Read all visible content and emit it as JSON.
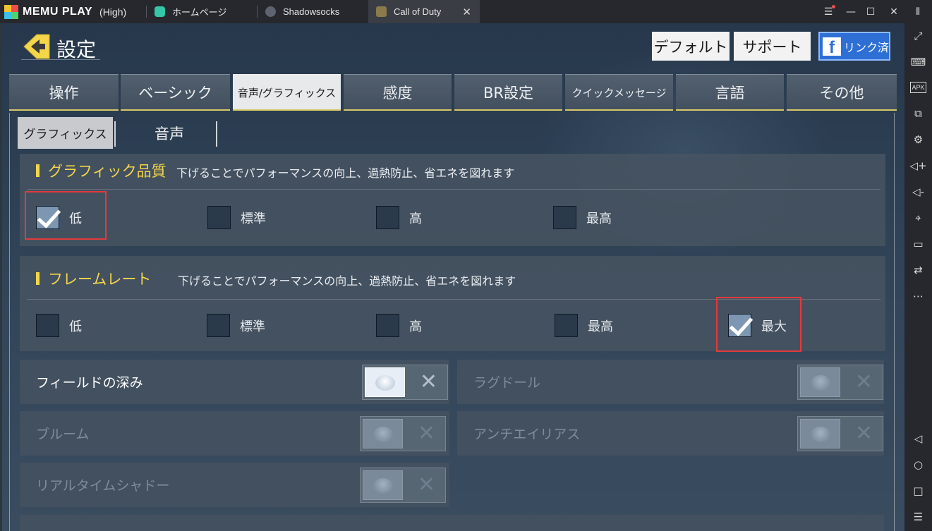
{
  "titlebar": {
    "app_name": "MEMU PLAY",
    "quality": "(High)",
    "tabs": [
      {
        "label": "ホームページ"
      },
      {
        "label": "Shadowsocks"
      },
      {
        "label": "Call of Duty",
        "active": true
      }
    ]
  },
  "header": {
    "title": "設定",
    "default_button": "デフォルト",
    "support_button": "サポート",
    "facebook_icon": "f",
    "facebook_button": "リンク済"
  },
  "main_tabs": [
    "操作",
    "ベーシック",
    "音声/グラフィックス",
    "感度",
    "BR設定",
    "クイックメッセージ",
    "言語",
    "その他"
  ],
  "sub_tabs": [
    "グラフィックス",
    "音声"
  ],
  "graphics_quality": {
    "title": "グラフィック品質",
    "description": "下げることでパフォーマンスの向上、過熱防止、省エネを図れます",
    "options": [
      {
        "label": "低",
        "checked": true
      },
      {
        "label": "標準",
        "checked": false
      },
      {
        "label": "高",
        "checked": false
      },
      {
        "label": "最高",
        "checked": false
      }
    ]
  },
  "frame_rate": {
    "title": "フレームレート",
    "description": "下げることでパフォーマンスの向上、過熱防止、省エネを図れます",
    "options": [
      {
        "label": "低",
        "checked": false
      },
      {
        "label": "標準",
        "checked": false
      },
      {
        "label": "高",
        "checked": false
      },
      {
        "label": "最高",
        "checked": false
      },
      {
        "label": "最大",
        "checked": true
      }
    ]
  },
  "toggles": {
    "depth_of_field": "フィールドの深み",
    "ragdoll": "ラグドール",
    "bloom": "ブルーム",
    "anti_aliasing": "アンチエイリアス",
    "realtime_shadow": "リアルタイムシャドー"
  },
  "colors": {
    "accent_yellow": "#f4d64a",
    "highlight_red": "#e23b3b",
    "facebook_blue": "#2e6fd6"
  }
}
